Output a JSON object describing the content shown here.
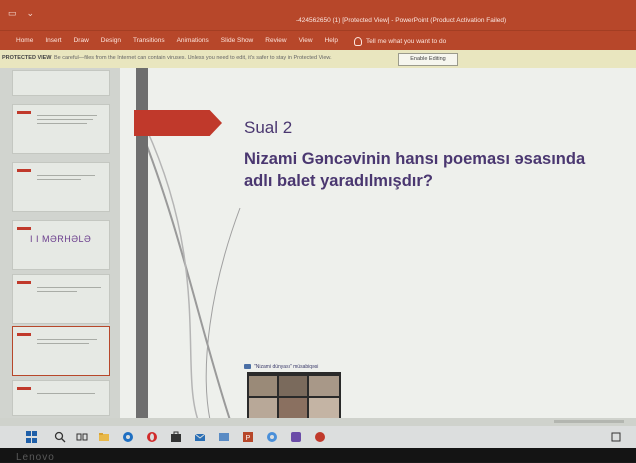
{
  "window": {
    "title": "-424562650 (1) [Protected View] - PowerPoint (Product Activation Failed)"
  },
  "ribbon": {
    "tabs": [
      "Home",
      "Insert",
      "Draw",
      "Design",
      "Transitions",
      "Animations",
      "Slide Show",
      "Review",
      "View",
      "Help"
    ],
    "tell_me": "Tell me what you want to do"
  },
  "protected_view": {
    "label": "PROTECTED VIEW",
    "message": "Be careful—files from the Internet can contain viruses. Unless you need to edit, it's safer to stay in Protected View.",
    "enable_button": "Enable Editing"
  },
  "thumbnails": {
    "section_label": "I I MƏRHƏLƏ"
  },
  "slide": {
    "heading": "Sual 2",
    "question_line1": "Nizami Gəncəvinin hansı poeması əsasında",
    "question_line2": "adlı balet yaradılmışdır?"
  },
  "video": {
    "caption": "\"Nizami dünyası\" müsabiqəsi"
  },
  "colors": {
    "ribbon": "#b7472a",
    "slide_text": "#4a3770",
    "accent_red": "#c0392b"
  },
  "icons": {
    "start": "windows-start-icon",
    "search": "search-icon",
    "task_view": "task-view-icon",
    "edge": "edge-icon",
    "opera": "opera-icon",
    "store": "store-icon",
    "mail": "mail-icon",
    "powerpoint": "powerpoint-icon"
  },
  "bezel": {
    "brand": "Lenovo"
  }
}
